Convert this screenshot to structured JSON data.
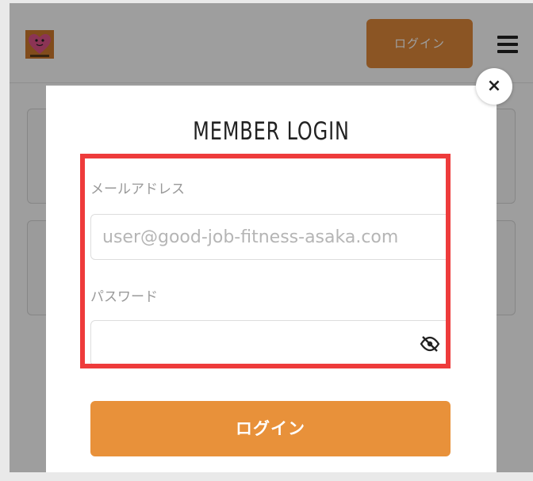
{
  "header": {
    "logo_icon": "heart-mascot-logo",
    "login_label": "ログイン",
    "menu_icon": "hamburger-menu-icon"
  },
  "modal": {
    "title": "MEMBER LOGIN",
    "close_icon": "close-icon",
    "close_symbol": "×",
    "email": {
      "label": "メールアドレス",
      "placeholder": "user@good-job-fitness-asaka.com",
      "value": ""
    },
    "password": {
      "label": "パスワード",
      "value": "",
      "toggle_icon": "eye-slash-icon"
    },
    "submit_label": "ログイン"
  },
  "colors": {
    "accent": "#e8913a",
    "highlight": "#ee3b3b",
    "overlay": "rgba(0,0,0,0.38)"
  }
}
